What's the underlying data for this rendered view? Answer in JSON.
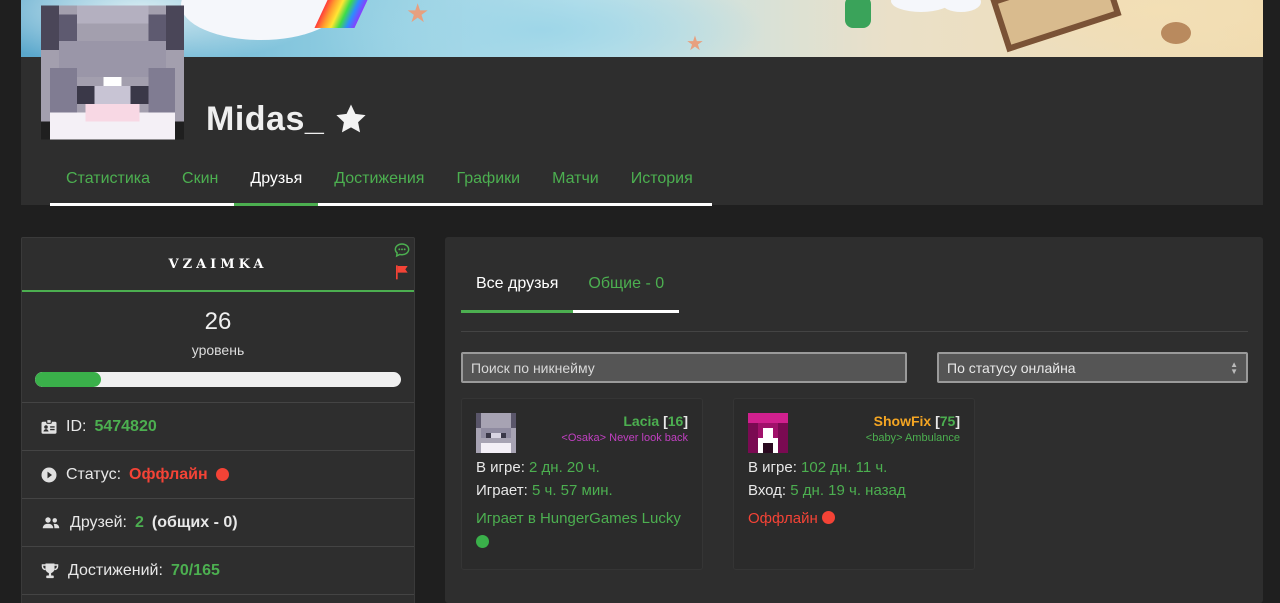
{
  "player": {
    "name": "Midas_"
  },
  "nav": {
    "tabs": [
      "Статистика",
      "Скин",
      "Друзья",
      "Достижения",
      "Графики",
      "Матчи",
      "История"
    ],
    "active": 2
  },
  "profile": {
    "guild": "VZAIMKA",
    "level": "26",
    "level_label": "уровень",
    "level_progress": 0.18,
    "id_label": "ID:",
    "id_value": "5474820",
    "status_label": "Статус:",
    "status_value": "Оффлайн",
    "friends_label": "Друзей:",
    "friends_value": "2",
    "friends_common": "(общих - 0)",
    "ach_label": "Достижений:",
    "ach_value": "70/165"
  },
  "friends_panel": {
    "tab_all": "Все друзья",
    "tab_common": "Общие - 0",
    "search_placeholder": "Поиск по никнейму",
    "status_filter": "По статусу онлайна"
  },
  "friends": [
    {
      "name": "Lacia",
      "name_color": "#4caf50",
      "level": "16",
      "guild_open": "<",
      "guild_tag": "Osaka",
      "guild_close": ">",
      "guild_motto": "Never look back",
      "guild_tag_color": "#c040c0",
      "guild_motto_color": "#c040c0",
      "line1_label": "В игре:",
      "line1_value": "2 дн. 20 ч.",
      "line2_label": "Играет:",
      "line2_value": "5 ч. 57 мин.",
      "status": "Играет в HungerGames Lucky",
      "status_color": "#4caf50",
      "status_dot": "green"
    },
    {
      "name": "ShowFix",
      "name_color": "#f5a623",
      "level": "75",
      "guild_open": "<",
      "guild_tag": "baby",
      "guild_close": ">",
      "guild_motto": "Ambulance",
      "guild_tag_color": "#4caf50",
      "guild_motto_color": "#4caf50",
      "line1_label": "В игре:",
      "line1_value": "102 дн. 11 ч.",
      "line2_label": "Вход:",
      "line2_value": "5 дн. 19 ч. назад",
      "status": "Оффлайн",
      "status_color": "#f44336",
      "status_dot": "red"
    }
  ],
  "icons": {
    "star": "star-icon",
    "chat": "chat-bubble-icon",
    "flag": "flag-icon",
    "id": "id-card-icon",
    "status": "play-circle-icon",
    "friends": "users-icon",
    "achievements": "trophy-icon"
  },
  "colors": {
    "accent": "#4caf50",
    "offline": "#f44336",
    "panel": "#2e2e2e",
    "background": "#1f1f1f"
  }
}
